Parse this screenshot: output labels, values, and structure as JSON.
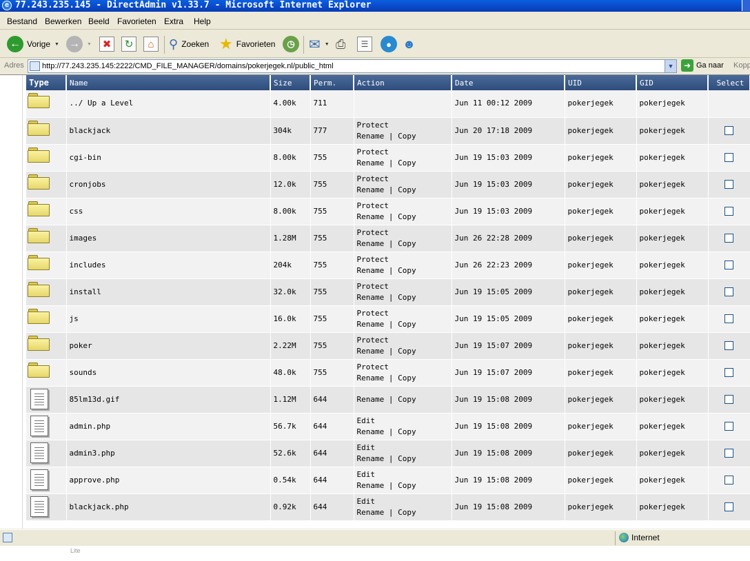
{
  "window": {
    "title": "77.243.235.145 - DirectAdmin v1.33.7 - Microsoft Internet Explorer"
  },
  "menu": [
    "Bestand",
    "Bewerken",
    "Beeld",
    "Favorieten",
    "Extra",
    "Help"
  ],
  "toolbar": {
    "back_label": "Vorige",
    "search_label": "Zoeken",
    "favorites_label": "Favorieten"
  },
  "address": {
    "label": "Adres",
    "url": "http://77.243.235.145:2222/CMD_FILE_MANAGER/domains/pokerjegek.nl/public_html",
    "go_label": "Ga naar",
    "links_label": "Kopp"
  },
  "table": {
    "headers": {
      "type": "Type",
      "name": "Name",
      "size": "Size",
      "perm": "Perm.",
      "action": "Action",
      "date": "Date",
      "uid": "UID",
      "gid": "GID",
      "select": "Select"
    },
    "rows": [
      {
        "kind": "folder",
        "name": "../ Up a Level",
        "size": "4.00k",
        "perm": "711",
        "action1": "",
        "action2": "",
        "date": "Jun 11 00:12 2009",
        "uid": "pokerjegek",
        "gid": "pokerjegek",
        "checkbox": false
      },
      {
        "kind": "folder",
        "name": "blackjack",
        "size": "304k",
        "perm": "777",
        "action1": "Protect",
        "action2": "Rename | Copy",
        "date": "Jun 20 17:18 2009",
        "uid": "pokerjegek",
        "gid": "pokerjegek",
        "checkbox": true
      },
      {
        "kind": "folder",
        "name": "cgi-bin",
        "size": "8.00k",
        "perm": "755",
        "action1": "Protect",
        "action2": "Rename | Copy",
        "date": "Jun 19 15:03 2009",
        "uid": "pokerjegek",
        "gid": "pokerjegek",
        "checkbox": true
      },
      {
        "kind": "folder",
        "name": "cronjobs",
        "size": "12.0k",
        "perm": "755",
        "action1": "Protect",
        "action2": "Rename | Copy",
        "date": "Jun 19 15:03 2009",
        "uid": "pokerjegek",
        "gid": "pokerjegek",
        "checkbox": true
      },
      {
        "kind": "folder",
        "name": "css",
        "size": "8.00k",
        "perm": "755",
        "action1": "Protect",
        "action2": "Rename | Copy",
        "date": "Jun 19 15:03 2009",
        "uid": "pokerjegek",
        "gid": "pokerjegek",
        "checkbox": true
      },
      {
        "kind": "folder",
        "name": "images",
        "size": "1.28M",
        "perm": "755",
        "action1": "Protect",
        "action2": "Rename | Copy",
        "date": "Jun 26 22:28 2009",
        "uid": "pokerjegek",
        "gid": "pokerjegek",
        "checkbox": true
      },
      {
        "kind": "folder",
        "name": "includes",
        "size": "204k",
        "perm": "755",
        "action1": "Protect",
        "action2": "Rename | Copy",
        "date": "Jun 26 22:23 2009",
        "uid": "pokerjegek",
        "gid": "pokerjegek",
        "checkbox": true
      },
      {
        "kind": "folder",
        "name": "install",
        "size": "32.0k",
        "perm": "755",
        "action1": "Protect",
        "action2": "Rename | Copy",
        "date": "Jun 19 15:05 2009",
        "uid": "pokerjegek",
        "gid": "pokerjegek",
        "checkbox": true
      },
      {
        "kind": "folder",
        "name": "js",
        "size": "16.0k",
        "perm": "755",
        "action1": "Protect",
        "action2": "Rename | Copy",
        "date": "Jun 19 15:05 2009",
        "uid": "pokerjegek",
        "gid": "pokerjegek",
        "checkbox": true
      },
      {
        "kind": "folder",
        "name": "poker",
        "size": "2.22M",
        "perm": "755",
        "action1": "Protect",
        "action2": "Rename | Copy",
        "date": "Jun 19 15:07 2009",
        "uid": "pokerjegek",
        "gid": "pokerjegek",
        "checkbox": true
      },
      {
        "kind": "folder",
        "name": "sounds",
        "size": "48.0k",
        "perm": "755",
        "action1": "Protect",
        "action2": "Rename | Copy",
        "date": "Jun 19 15:07 2009",
        "uid": "pokerjegek",
        "gid": "pokerjegek",
        "checkbox": true
      },
      {
        "kind": "file",
        "name": "85lm13d.gif",
        "size": "1.12M",
        "perm": "644",
        "action1": "",
        "action2": "Rename | Copy",
        "date": "Jun 19 15:08 2009",
        "uid": "pokerjegek",
        "gid": "pokerjegek",
        "checkbox": true
      },
      {
        "kind": "file",
        "name": "admin.php",
        "size": "56.7k",
        "perm": "644",
        "action1": "Edit",
        "action2": "Rename | Copy",
        "date": "Jun 19 15:08 2009",
        "uid": "pokerjegek",
        "gid": "pokerjegek",
        "checkbox": true
      },
      {
        "kind": "file",
        "name": "admin3.php",
        "size": "52.6k",
        "perm": "644",
        "action1": "Edit",
        "action2": "Rename | Copy",
        "date": "Jun 19 15:08 2009",
        "uid": "pokerjegek",
        "gid": "pokerjegek",
        "checkbox": true
      },
      {
        "kind": "file",
        "name": "approve.php",
        "size": "0.54k",
        "perm": "644",
        "action1": "Edit",
        "action2": "Rename | Copy",
        "date": "Jun 19 15:08 2009",
        "uid": "pokerjegek",
        "gid": "pokerjegek",
        "checkbox": true
      },
      {
        "kind": "file",
        "name": "blackjack.php",
        "size": "0.92k",
        "perm": "644",
        "action1": "Edit",
        "action2": "Rename | Copy",
        "date": "Jun 19 15:08 2009",
        "uid": "pokerjegek",
        "gid": "pokerjegek",
        "checkbox": true
      }
    ]
  },
  "status": {
    "zone": "Internet"
  },
  "below_text": "Lite"
}
